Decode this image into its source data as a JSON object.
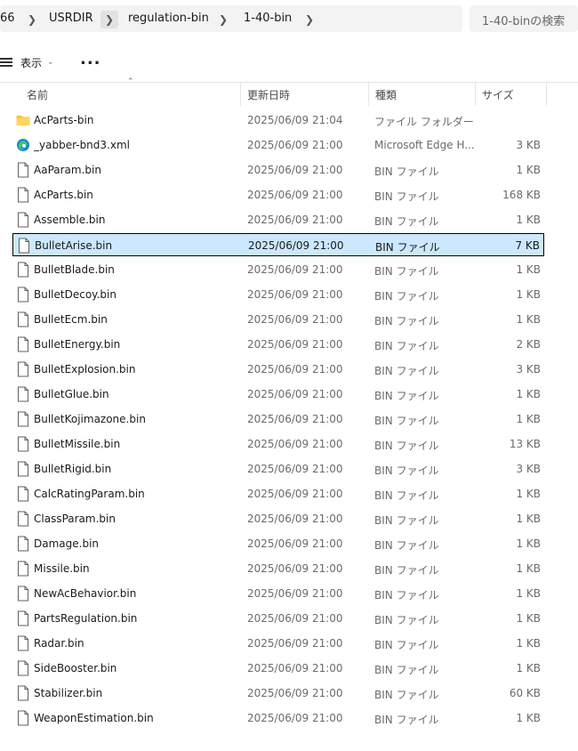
{
  "breadcrumb": {
    "items": [
      "66",
      "USRDIR",
      "regulation-bin",
      "1-40-bin"
    ],
    "separator": ">"
  },
  "search": {
    "placeholder": "1-40-binの検索"
  },
  "toolbar": {
    "view_label": "表示",
    "more_label": "..."
  },
  "columns": {
    "name": "名前",
    "date": "更新日時",
    "type": "種類",
    "size": "サイズ"
  },
  "files": [
    {
      "name": "AcParts-bin",
      "date": "2025/06/09 21:04",
      "type": "ファイル フォルダー",
      "size": "",
      "icon": "folder-icon"
    },
    {
      "name": "_yabber-bnd3.xml",
      "date": "2025/06/09 21:00",
      "type": "Microsoft Edge H...",
      "size": "3 KB",
      "icon": "edge-icon"
    },
    {
      "name": "AaParam.bin",
      "date": "2025/06/09 21:00",
      "type": "BIN ファイル",
      "size": "1 KB",
      "icon": "file-icon"
    },
    {
      "name": "AcParts.bin",
      "date": "2025/06/09 21:00",
      "type": "BIN ファイル",
      "size": "168 KB",
      "icon": "file-icon"
    },
    {
      "name": "Assemble.bin",
      "date": "2025/06/09 21:00",
      "type": "BIN ファイル",
      "size": "1 KB",
      "icon": "file-icon"
    },
    {
      "name": "BulletArise.bin",
      "date": "2025/06/09 21:00",
      "type": "BIN ファイル",
      "size": "7 KB",
      "icon": "file-icon",
      "selected": true
    },
    {
      "name": "BulletBlade.bin",
      "date": "2025/06/09 21:00",
      "type": "BIN ファイル",
      "size": "1 KB",
      "icon": "file-icon"
    },
    {
      "name": "BulletDecoy.bin",
      "date": "2025/06/09 21:00",
      "type": "BIN ファイル",
      "size": "1 KB",
      "icon": "file-icon"
    },
    {
      "name": "BulletEcm.bin",
      "date": "2025/06/09 21:00",
      "type": "BIN ファイル",
      "size": "1 KB",
      "icon": "file-icon"
    },
    {
      "name": "BulletEnergy.bin",
      "date": "2025/06/09 21:00",
      "type": "BIN ファイル",
      "size": "2 KB",
      "icon": "file-icon"
    },
    {
      "name": "BulletExplosion.bin",
      "date": "2025/06/09 21:00",
      "type": "BIN ファイル",
      "size": "3 KB",
      "icon": "file-icon"
    },
    {
      "name": "BulletGlue.bin",
      "date": "2025/06/09 21:00",
      "type": "BIN ファイル",
      "size": "1 KB",
      "icon": "file-icon"
    },
    {
      "name": "BulletKojimazone.bin",
      "date": "2025/06/09 21:00",
      "type": "BIN ファイル",
      "size": "1 KB",
      "icon": "file-icon"
    },
    {
      "name": "BulletMissile.bin",
      "date": "2025/06/09 21:00",
      "type": "BIN ファイル",
      "size": "13 KB",
      "icon": "file-icon"
    },
    {
      "name": "BulletRigid.bin",
      "date": "2025/06/09 21:00",
      "type": "BIN ファイル",
      "size": "3 KB",
      "icon": "file-icon"
    },
    {
      "name": "CalcRatingParam.bin",
      "date": "2025/06/09 21:00",
      "type": "BIN ファイル",
      "size": "1 KB",
      "icon": "file-icon"
    },
    {
      "name": "ClassParam.bin",
      "date": "2025/06/09 21:00",
      "type": "BIN ファイル",
      "size": "1 KB",
      "icon": "file-icon"
    },
    {
      "name": "Damage.bin",
      "date": "2025/06/09 21:00",
      "type": "BIN ファイル",
      "size": "1 KB",
      "icon": "file-icon"
    },
    {
      "name": "Missile.bin",
      "date": "2025/06/09 21:00",
      "type": "BIN ファイル",
      "size": "1 KB",
      "icon": "file-icon"
    },
    {
      "name": "NewAcBehavior.bin",
      "date": "2025/06/09 21:00",
      "type": "BIN ファイル",
      "size": "1 KB",
      "icon": "file-icon"
    },
    {
      "name": "PartsRegulation.bin",
      "date": "2025/06/09 21:00",
      "type": "BIN ファイル",
      "size": "1 KB",
      "icon": "file-icon"
    },
    {
      "name": "Radar.bin",
      "date": "2025/06/09 21:00",
      "type": "BIN ファイル",
      "size": "1 KB",
      "icon": "file-icon"
    },
    {
      "name": "SideBooster.bin",
      "date": "2025/06/09 21:00",
      "type": "BIN ファイル",
      "size": "1 KB",
      "icon": "file-icon"
    },
    {
      "name": "Stabilizer.bin",
      "date": "2025/06/09 21:00",
      "type": "BIN ファイル",
      "size": "60 KB",
      "icon": "file-icon"
    },
    {
      "name": "WeaponEstimation.bin",
      "date": "2025/06/09 21:00",
      "type": "BIN ファイル",
      "size": "1 KB",
      "icon": "file-icon"
    }
  ],
  "colors": {
    "selection": "#cce8ff",
    "folder": "#f4c23c",
    "edge": "#1a86d8"
  }
}
